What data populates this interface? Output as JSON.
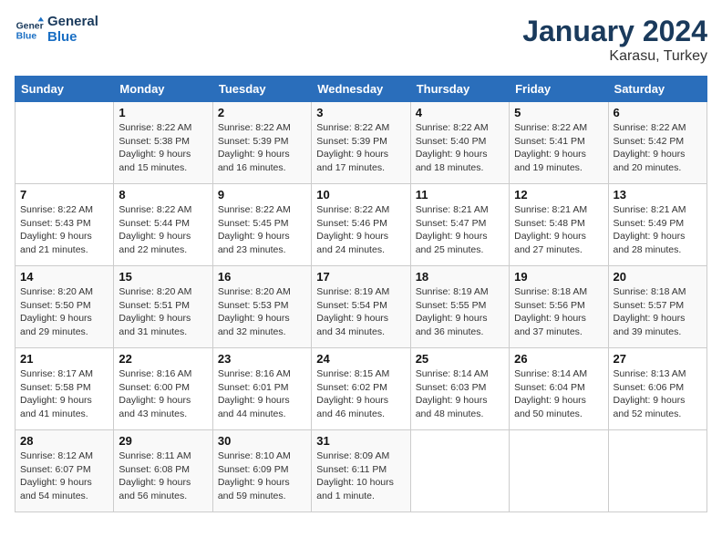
{
  "header": {
    "logo_line1": "General",
    "logo_line2": "Blue",
    "month": "January 2024",
    "location": "Karasu, Turkey"
  },
  "weekdays": [
    "Sunday",
    "Monday",
    "Tuesday",
    "Wednesday",
    "Thursday",
    "Friday",
    "Saturday"
  ],
  "weeks": [
    [
      {
        "day": "",
        "info": ""
      },
      {
        "day": "1",
        "info": "Sunrise: 8:22 AM\nSunset: 5:38 PM\nDaylight: 9 hours\nand 15 minutes."
      },
      {
        "day": "2",
        "info": "Sunrise: 8:22 AM\nSunset: 5:39 PM\nDaylight: 9 hours\nand 16 minutes."
      },
      {
        "day": "3",
        "info": "Sunrise: 8:22 AM\nSunset: 5:39 PM\nDaylight: 9 hours\nand 17 minutes."
      },
      {
        "day": "4",
        "info": "Sunrise: 8:22 AM\nSunset: 5:40 PM\nDaylight: 9 hours\nand 18 minutes."
      },
      {
        "day": "5",
        "info": "Sunrise: 8:22 AM\nSunset: 5:41 PM\nDaylight: 9 hours\nand 19 minutes."
      },
      {
        "day": "6",
        "info": "Sunrise: 8:22 AM\nSunset: 5:42 PM\nDaylight: 9 hours\nand 20 minutes."
      }
    ],
    [
      {
        "day": "7",
        "info": "Sunrise: 8:22 AM\nSunset: 5:43 PM\nDaylight: 9 hours\nand 21 minutes."
      },
      {
        "day": "8",
        "info": "Sunrise: 8:22 AM\nSunset: 5:44 PM\nDaylight: 9 hours\nand 22 minutes."
      },
      {
        "day": "9",
        "info": "Sunrise: 8:22 AM\nSunset: 5:45 PM\nDaylight: 9 hours\nand 23 minutes."
      },
      {
        "day": "10",
        "info": "Sunrise: 8:22 AM\nSunset: 5:46 PM\nDaylight: 9 hours\nand 24 minutes."
      },
      {
        "day": "11",
        "info": "Sunrise: 8:21 AM\nSunset: 5:47 PM\nDaylight: 9 hours\nand 25 minutes."
      },
      {
        "day": "12",
        "info": "Sunrise: 8:21 AM\nSunset: 5:48 PM\nDaylight: 9 hours\nand 27 minutes."
      },
      {
        "day": "13",
        "info": "Sunrise: 8:21 AM\nSunset: 5:49 PM\nDaylight: 9 hours\nand 28 minutes."
      }
    ],
    [
      {
        "day": "14",
        "info": "Sunrise: 8:20 AM\nSunset: 5:50 PM\nDaylight: 9 hours\nand 29 minutes."
      },
      {
        "day": "15",
        "info": "Sunrise: 8:20 AM\nSunset: 5:51 PM\nDaylight: 9 hours\nand 31 minutes."
      },
      {
        "day": "16",
        "info": "Sunrise: 8:20 AM\nSunset: 5:53 PM\nDaylight: 9 hours\nand 32 minutes."
      },
      {
        "day": "17",
        "info": "Sunrise: 8:19 AM\nSunset: 5:54 PM\nDaylight: 9 hours\nand 34 minutes."
      },
      {
        "day": "18",
        "info": "Sunrise: 8:19 AM\nSunset: 5:55 PM\nDaylight: 9 hours\nand 36 minutes."
      },
      {
        "day": "19",
        "info": "Sunrise: 8:18 AM\nSunset: 5:56 PM\nDaylight: 9 hours\nand 37 minutes."
      },
      {
        "day": "20",
        "info": "Sunrise: 8:18 AM\nSunset: 5:57 PM\nDaylight: 9 hours\nand 39 minutes."
      }
    ],
    [
      {
        "day": "21",
        "info": "Sunrise: 8:17 AM\nSunset: 5:58 PM\nDaylight: 9 hours\nand 41 minutes."
      },
      {
        "day": "22",
        "info": "Sunrise: 8:16 AM\nSunset: 6:00 PM\nDaylight: 9 hours\nand 43 minutes."
      },
      {
        "day": "23",
        "info": "Sunrise: 8:16 AM\nSunset: 6:01 PM\nDaylight: 9 hours\nand 44 minutes."
      },
      {
        "day": "24",
        "info": "Sunrise: 8:15 AM\nSunset: 6:02 PM\nDaylight: 9 hours\nand 46 minutes."
      },
      {
        "day": "25",
        "info": "Sunrise: 8:14 AM\nSunset: 6:03 PM\nDaylight: 9 hours\nand 48 minutes."
      },
      {
        "day": "26",
        "info": "Sunrise: 8:14 AM\nSunset: 6:04 PM\nDaylight: 9 hours\nand 50 minutes."
      },
      {
        "day": "27",
        "info": "Sunrise: 8:13 AM\nSunset: 6:06 PM\nDaylight: 9 hours\nand 52 minutes."
      }
    ],
    [
      {
        "day": "28",
        "info": "Sunrise: 8:12 AM\nSunset: 6:07 PM\nDaylight: 9 hours\nand 54 minutes."
      },
      {
        "day": "29",
        "info": "Sunrise: 8:11 AM\nSunset: 6:08 PM\nDaylight: 9 hours\nand 56 minutes."
      },
      {
        "day": "30",
        "info": "Sunrise: 8:10 AM\nSunset: 6:09 PM\nDaylight: 9 hours\nand 59 minutes."
      },
      {
        "day": "31",
        "info": "Sunrise: 8:09 AM\nSunset: 6:11 PM\nDaylight: 10 hours\nand 1 minute."
      },
      {
        "day": "",
        "info": ""
      },
      {
        "day": "",
        "info": ""
      },
      {
        "day": "",
        "info": ""
      }
    ]
  ]
}
